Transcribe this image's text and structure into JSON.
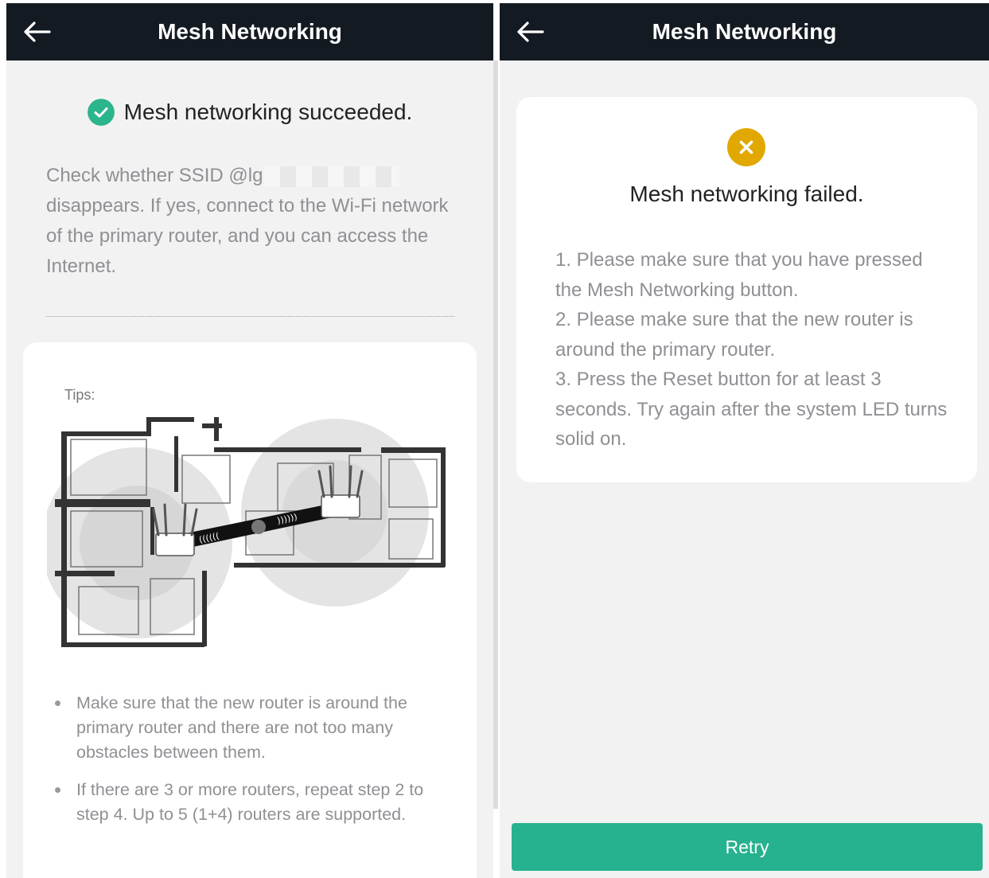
{
  "colors": {
    "header_bg": "#141a22",
    "success_green": "#2bb58c",
    "fail_yellow": "#e0a800",
    "button_green": "#26b28e"
  },
  "left": {
    "header": {
      "title": "Mesh Networking",
      "back_icon": "arrow-left-icon"
    },
    "status": {
      "icon": "check-circle-icon",
      "text": "Mesh networking succeeded."
    },
    "description": {
      "prefix": "Check whether SSID @lg",
      "rest": "disappears. If yes, connect to the Wi-Fi network of the primary router, and you can access the Internet."
    },
    "tips": {
      "label": "Tips:",
      "items": [
        "Make sure that the new router is around the primary router and there are not too many obstacles between them.",
        "If there are 3 or more routers, repeat step 2 to step 4. Up to 5 (1+4) routers are supported."
      ]
    }
  },
  "right": {
    "header": {
      "title": "Mesh Networking",
      "back_icon": "arrow-left-icon"
    },
    "status": {
      "icon": "x-circle-icon",
      "text": "Mesh networking failed."
    },
    "steps": [
      "1. Please make sure that you have pressed the Mesh Networking button.",
      "2. Please make sure that the new router is around the primary router.",
      "3. Press the Reset button for at least 3 seconds. Try again after the system LED turns solid on."
    ],
    "retry_label": "Retry"
  }
}
